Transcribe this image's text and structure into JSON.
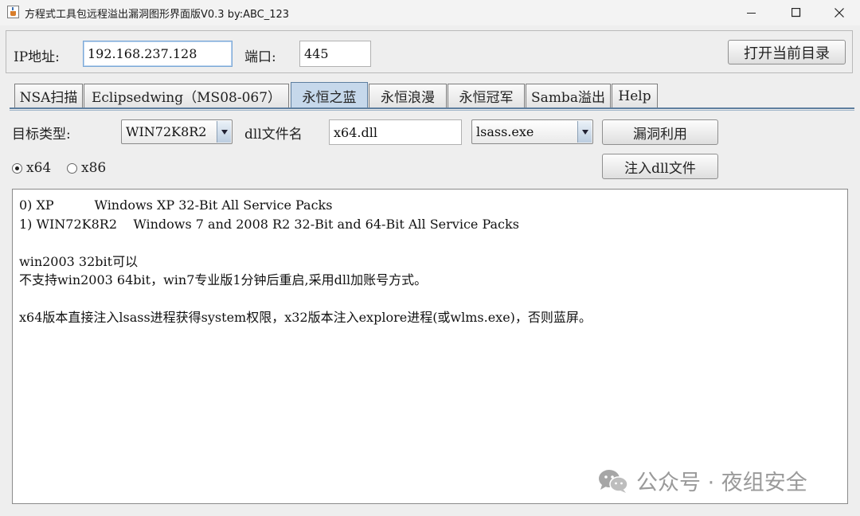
{
  "window": {
    "title": "方程式工具包远程溢出漏洞图形界面版V0.3 by:ABC_123"
  },
  "connection": {
    "ip_label": "IP地址:",
    "ip_value": "192.168.237.128",
    "port_label": "端口:",
    "port_value": "445",
    "open_dir_label": "打开当前目录"
  },
  "tabs": [
    {
      "label": "NSA扫描",
      "active": false
    },
    {
      "label": "Eclipsedwing（MS08-067）",
      "active": false
    },
    {
      "label": "永恒之蓝",
      "active": true
    },
    {
      "label": "永恒浪漫",
      "active": false
    },
    {
      "label": "永恒冠军",
      "active": false
    },
    {
      "label": "Samba溢出",
      "active": false
    },
    {
      "label": "Help",
      "active": false
    }
  ],
  "form": {
    "target_type_label": "目标类型:",
    "target_type_value": "WIN72K8R2",
    "dll_label": "dll文件名",
    "dll_value": "x64.dll",
    "process_value": "lsass.exe",
    "exploit_button": "漏洞利用",
    "inject_button": "注入dll文件",
    "arch_options": [
      {
        "label": "x64",
        "selected": true
      },
      {
        "label": "x86",
        "selected": false
      }
    ]
  },
  "output": {
    "lines": [
      "0) XP          Windows XP 32-Bit All Service Packs",
      "1) WIN72K8R2    Windows 7 and 2008 R2 32-Bit and 64-Bit All Service Packs",
      "",
      "win2003 32bit可以",
      "不支持win2003 64bit，win7专业版1分钟后重启,采用dll加账号方式。",
      "",
      "x64版本直接注入lsass进程获得system权限，x32版本注入explore进程(或wlms.exe)，否则蓝屏。"
    ]
  },
  "watermark": {
    "text": "公众号 · 夜组安全"
  },
  "icons": {
    "app": "java-coffee-icon",
    "watermark": "wechat-icon"
  }
}
